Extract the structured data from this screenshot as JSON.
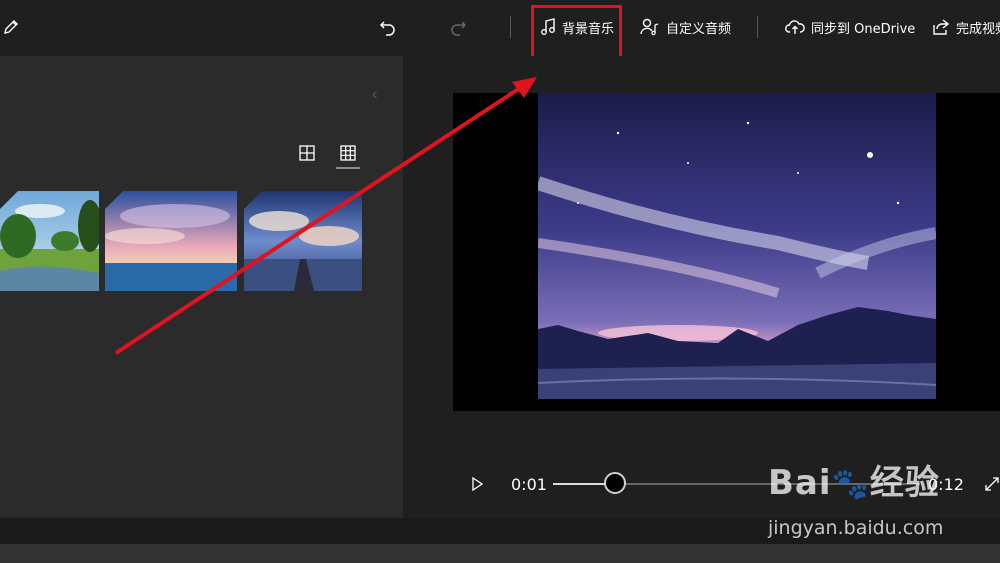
{
  "toolbar": {
    "background_music_label": "背景音乐",
    "custom_audio_label": "自定义音频",
    "sync_label": "同步到 OneDrive",
    "finish_label": "完成视频"
  },
  "player": {
    "current_time": "0:01",
    "total_time": "0:12",
    "progress_fraction": 0.08
  },
  "watermark": {
    "brand_left": "Bai",
    "brand_right": "经验",
    "url": "jingyan.baidu.com"
  },
  "colors": {
    "highlight_red": "#e0141e",
    "background": "#1f1f1f",
    "panel": "#2b2b2b"
  }
}
